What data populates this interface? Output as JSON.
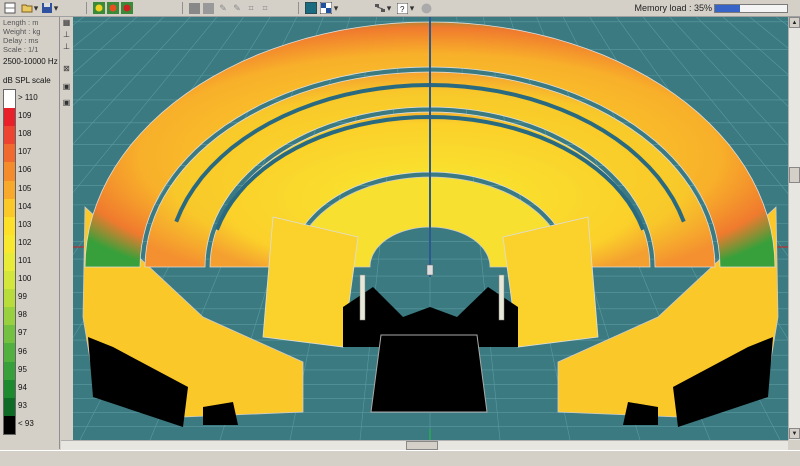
{
  "toolbar": {
    "memory_label": "Memory load : 35%",
    "memory_fraction": 0.35
  },
  "sidebar": {
    "info": [
      "Length : m",
      "Weight : kg",
      "Delay : ms",
      "Scale : 1/1"
    ],
    "frequency": "2500-10000 Hz",
    "scale_title": "dB SPL scale",
    "scale": [
      {
        "label": "> 110",
        "color": "#ffffff"
      },
      {
        "label": "109",
        "color": "#e8202a"
      },
      {
        "label": "108",
        "color": "#ec4430"
      },
      {
        "label": "107",
        "color": "#f06a30"
      },
      {
        "label": "106",
        "color": "#f48c2c"
      },
      {
        "label": "105",
        "color": "#f8a82a"
      },
      {
        "label": "104",
        "color": "#fbc82a"
      },
      {
        "label": "103",
        "color": "#fde02a"
      },
      {
        "label": "102",
        "color": "#f8e830"
      },
      {
        "label": "101",
        "color": "#e8ec38"
      },
      {
        "label": "100",
        "color": "#d2e63c"
      },
      {
        "label": "99",
        "color": "#b8dc3c"
      },
      {
        "label": "98",
        "color": "#98d040"
      },
      {
        "label": "97",
        "color": "#74c040"
      },
      {
        "label": "96",
        "color": "#52b03e"
      },
      {
        "label": "95",
        "color": "#38a03a"
      },
      {
        "label": "94",
        "color": "#1e8a30"
      },
      {
        "label": "93",
        "color": "#0e6a24"
      },
      {
        "label": "< 93",
        "color": "#000000"
      }
    ]
  },
  "colors": {
    "viewport_bg": "#3a7a80",
    "grid_line": "#5a9aa0",
    "panel": "#d4d0c8",
    "shadow_zone": "#000000"
  }
}
